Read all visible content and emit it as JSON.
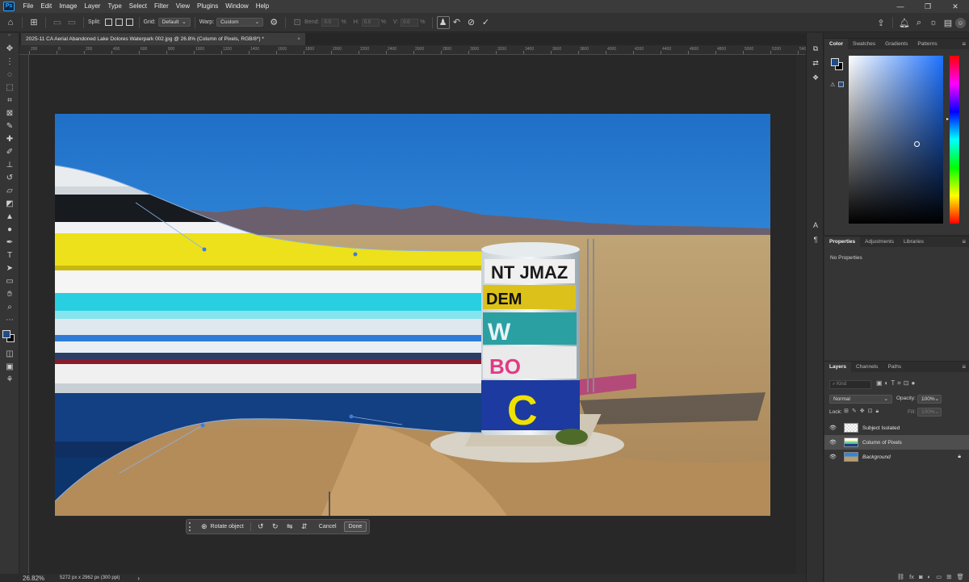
{
  "app": {
    "logo_text": "Ps"
  },
  "menu": [
    "File",
    "Edit",
    "Image",
    "Layer",
    "Type",
    "Select",
    "Filter",
    "View",
    "Plugins",
    "Window",
    "Help"
  ],
  "window_controls": [
    "—",
    "❐",
    "✕"
  ],
  "options": {
    "split_label": "Split:",
    "grid_label": "Grid:",
    "grid_value": "Default",
    "warp_label": "Warp:",
    "warp_value": "Custom",
    "bend_label": "Bend:",
    "bend_value": "0.0",
    "pct": "%",
    "h_label": "H:",
    "h_value": "0.0",
    "v_label": "V:",
    "v_value": "0.0"
  },
  "document_tab": {
    "title": "2025-11 CA Aerial Abandoned Lake Dolores Waterpark 002.jpg @ 26.8% (Column of Pixels, RGB/8*) *",
    "close": "×"
  },
  "ruler_ticks": [
    "200",
    "0",
    "200",
    "400",
    "600",
    "800",
    "1000",
    "1200",
    "1400",
    "1600",
    "1800",
    "2000",
    "2200",
    "2400",
    "2600",
    "2800",
    "3000",
    "3200",
    "3400",
    "3600",
    "3800",
    "4000",
    "4200",
    "4400",
    "4600",
    "4800",
    "5000",
    "5200",
    "540"
  ],
  "contextual_bar": {
    "rotate_label": "Rotate object",
    "cancel_label": "Cancel",
    "done_label": "Done"
  },
  "status": {
    "zoom": "26.82%",
    "doc_info": "5272 px x 2962 px (300 ppi)",
    "arrow": "›"
  },
  "color_panel": {
    "tabs": [
      "Color",
      "Swatches",
      "Gradients",
      "Patterns"
    ],
    "foreground": "#1d4c86",
    "background": "#000000",
    "hue_color": "#1e72ff"
  },
  "properties_panel": {
    "tabs": [
      "Properties",
      "Adjustments",
      "Libraries"
    ],
    "empty_text": "No Properties"
  },
  "layers_panel": {
    "tabs": [
      "Layers",
      "Channels",
      "Paths"
    ],
    "kind_placeholder": "Kind",
    "blend_mode": "Normal",
    "opacity_label": "Opacity:",
    "opacity_value": "100%",
    "lock_label": "Lock:",
    "fill_label": "Fill:",
    "fill_value": "100%",
    "layers": [
      {
        "name": "Subject Isolated",
        "selected": false,
        "locked": false,
        "italic": false
      },
      {
        "name": "Column of Pixels",
        "selected": true,
        "locked": false,
        "italic": false
      },
      {
        "name": "Background",
        "selected": false,
        "locked": true,
        "italic": true
      }
    ]
  },
  "icons": {
    "toolbar": [
      "move-icon",
      "artboard-icon",
      "lasso-icon",
      "object-select-icon",
      "crop-icon",
      "frame-icon",
      "eyedropper-icon",
      "healing-brush-icon",
      "brush-icon",
      "clone-stamp-icon",
      "history-brush-icon",
      "eraser-icon",
      "gradient-icon",
      "blur-icon",
      "dodge-icon",
      "pen-icon",
      "type-icon",
      "path-select-icon",
      "rectangle-icon",
      "hand-icon",
      "zoom-icon",
      "more-tools-icon"
    ],
    "accent": "#31a8ff"
  }
}
